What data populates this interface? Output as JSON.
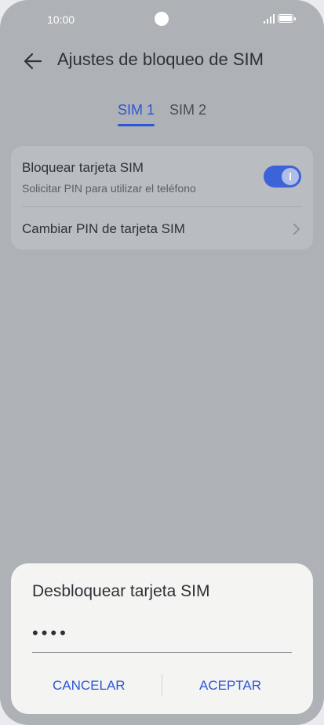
{
  "status_bar": {
    "time": "10:00",
    "signal_icon": "signal-icon",
    "battery_icon": "battery-icon"
  },
  "header": {
    "title": "Ajustes de bloqueo de SIM",
    "back_icon": "arrow-left-icon"
  },
  "tabs": [
    {
      "label": "SIM 1",
      "selected": true
    },
    {
      "label": "SIM 2",
      "selected": false
    }
  ],
  "settings": {
    "lock_sim": {
      "title": "Bloquear tarjeta SIM",
      "subtitle": "Solicitar PIN para utilizar el teléfono",
      "enabled": true
    },
    "change_pin": {
      "title": "Cambiar PIN de tarjeta SIM",
      "icon": "chevron-right-icon"
    }
  },
  "dialog": {
    "title": "Desbloquear tarjeta SIM",
    "pin_value": "••••",
    "cancel_label": "CANCELAR",
    "accept_label": "ACEPTAR"
  },
  "colors": {
    "accent": "#2d56d6",
    "toggle_on": "#3d63d8",
    "background": "#aeb1b5",
    "dialog": "#f4f4f3"
  }
}
